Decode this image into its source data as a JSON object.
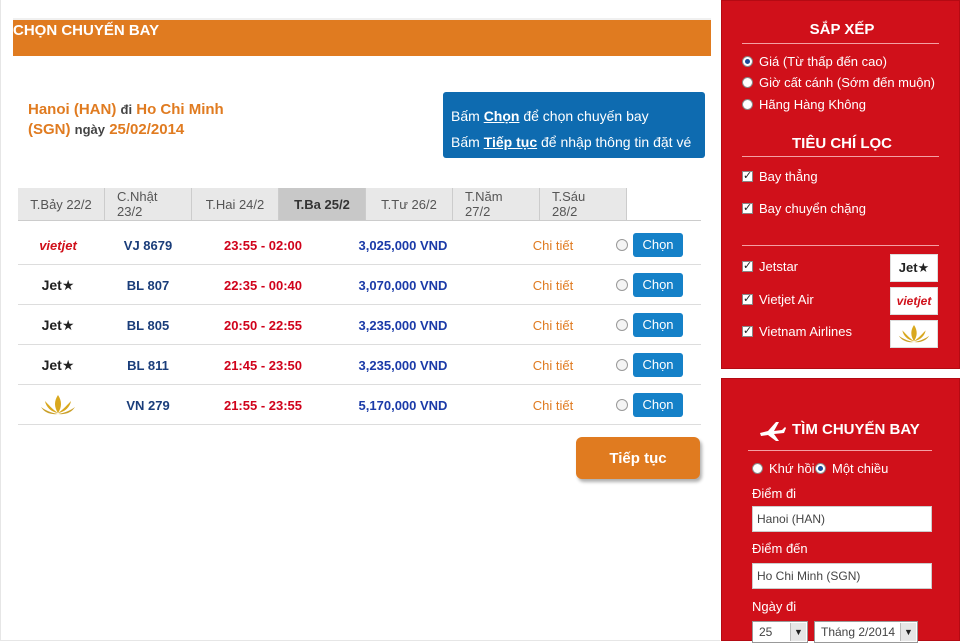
{
  "header": {
    "title": "CHỌN CHUYẾN BAY"
  },
  "route": {
    "from": "Hanoi (HAN)",
    "word_to": "đi",
    "to_line1": "Ho Chi Minh",
    "to_line2": "(SGN)",
    "word_date": "ngày",
    "date": "25/02/2014"
  },
  "hint": {
    "line1_prefix": "Bấm",
    "line1_key": "Chọn",
    "line1_suffix": "để chọn chuyến bay",
    "line2_prefix": "Bấm",
    "line2_key": "Tiếp tục",
    "line2_suffix": "để nhập thông tin đặt vé"
  },
  "date_tabs": [
    {
      "label": "T.Bảy 22/2",
      "active": false
    },
    {
      "label": "C.Nhật 23/2",
      "active": false
    },
    {
      "label": "T.Hai 24/2",
      "active": false
    },
    {
      "label": "T.Ba 25/2",
      "active": true
    },
    {
      "label": "T.Tư 26/2",
      "active": false
    },
    {
      "label": "T.Năm 27/2",
      "active": false
    },
    {
      "label": "T.Sáu 28/2",
      "active": false
    }
  ],
  "flights": [
    {
      "airline": "vietjet",
      "logo_text": "vietjet",
      "flight_no": "VJ 8679",
      "time": "23:55 - 02:00",
      "price": "3,025,000 VND",
      "detail": "Chi tiết",
      "choose": "Chọn"
    },
    {
      "airline": "jetstar",
      "logo_text": "Jet★",
      "flight_no": "BL 807",
      "time": "22:35 - 00:40",
      "price": "3,070,000 VND",
      "detail": "Chi tiết",
      "choose": "Chọn"
    },
    {
      "airline": "jetstar",
      "logo_text": "Jet★",
      "flight_no": "BL 805",
      "time": "20:50 - 22:55",
      "price": "3,235,000 VND",
      "detail": "Chi tiết",
      "choose": "Chọn"
    },
    {
      "airline": "jetstar",
      "logo_text": "Jet★",
      "flight_no": "BL 811",
      "time": "21:45 - 23:50",
      "price": "3,235,000 VND",
      "detail": "Chi tiết",
      "choose": "Chọn"
    },
    {
      "airline": "vietnam-airlines",
      "logo_text": "",
      "flight_no": "VN 279",
      "time": "21:55 - 23:55",
      "price": "5,170,000 VND",
      "detail": "Chi tiết",
      "choose": "Chọn"
    }
  ],
  "continue_button": "Tiếp tục",
  "sort": {
    "title": "SẮP XẾP",
    "options": [
      {
        "label": "Giá (Từ thấp đến cao)",
        "checked": true
      },
      {
        "label": "Giờ cất cánh (Sớm đến muộn)",
        "checked": false
      },
      {
        "label": "Hãng Hàng Không",
        "checked": false
      }
    ]
  },
  "filter": {
    "title": "TIÊU CHÍ LỌC",
    "stops": [
      {
        "label": "Bay thẳng",
        "checked": true
      },
      {
        "label": "Bay chuyển chặng",
        "checked": true
      }
    ],
    "airlines": [
      {
        "label": "Jetstar",
        "checked": true,
        "logo": "Jet★"
      },
      {
        "label": "Vietjet Air",
        "checked": true,
        "logo": "vietjet"
      },
      {
        "label": "Vietnam Airlines",
        "checked": true,
        "logo": ""
      }
    ]
  },
  "search": {
    "title": "TÌM CHUYẾN BAY",
    "trip_roundtrip": "Khứ hồi",
    "trip_oneway": "Một chiều",
    "trip_selected": "oneway",
    "from_label": "Điểm đi",
    "from_value": "Hanoi (HAN)",
    "to_label": "Điểm đến",
    "to_value": "Ho Chi Minh (SGN)",
    "date_label": "Ngày đi",
    "day_value": "25",
    "month_value": "Tháng 2/2014"
  },
  "colors": {
    "brand_orange": "#e07b20",
    "brand_red": "#d0101a",
    "button_blue": "#1581c8",
    "hint_blue": "#0e6bb0"
  }
}
